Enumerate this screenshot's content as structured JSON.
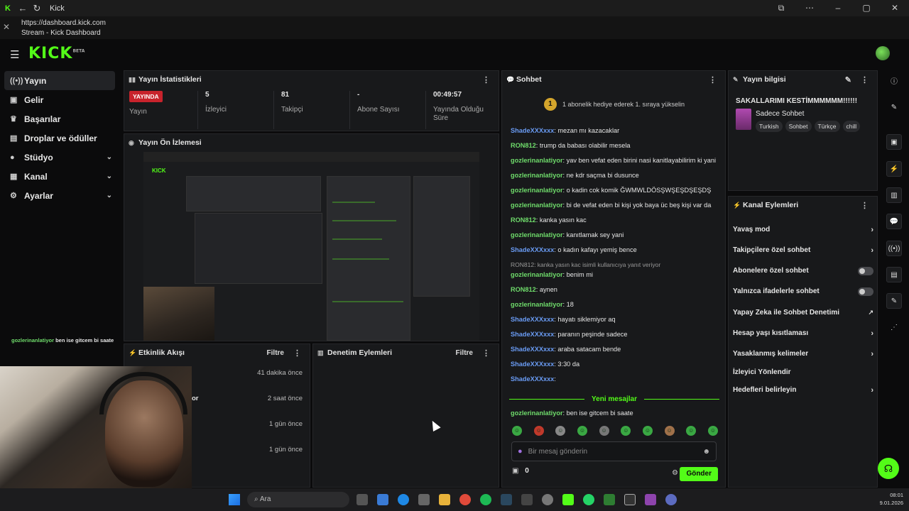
{
  "titlebar": {
    "title": "Kick"
  },
  "urlbar": {
    "url": "https://dashboard.kick.com",
    "page_title": "Stream - Kick Dashboard"
  },
  "brand": {
    "logo": "KICK",
    "logo_suffix": "BETA",
    "accent": "#53fc18"
  },
  "sidebar": {
    "items": [
      {
        "label": "Yayın",
        "icon": "broadcast-icon",
        "active": true
      },
      {
        "label": "Gelir",
        "icon": "revenue-icon"
      },
      {
        "label": "Başarılar",
        "icon": "trophy-icon"
      },
      {
        "label": "Droplar ve ödüller",
        "icon": "gift-icon"
      },
      {
        "label": "Stüdyo",
        "icon": "studio-icon",
        "expandable": true
      },
      {
        "label": "Kanal",
        "icon": "channel-icon",
        "expandable": true
      },
      {
        "label": "Ayarlar",
        "icon": "settings-icon",
        "expandable": true
      }
    ]
  },
  "stats": {
    "title": "Yayın İstatistikleri",
    "live_badge": "YAYINDA",
    "cells": [
      {
        "value": "",
        "label": "Yayın"
      },
      {
        "value": "5",
        "label": "İzleyici"
      },
      {
        "value": "81",
        "label": "Takipçi"
      },
      {
        "value": "-",
        "label": "Abone Sayısı"
      },
      {
        "value": "00:49:57",
        "label": "Yayında Olduğu Süre"
      }
    ]
  },
  "preview": {
    "title": "Yayın Ön İzlemesi"
  },
  "activity": {
    "title": "Etkinlik Akışı",
    "filter_label": "Filtre",
    "rows": [
      {
        "time": "41 dakika önce",
        "fragment": ""
      },
      {
        "time": "2 saat önce",
        "fragment": "or"
      },
      {
        "time": "1 gün önce",
        "fragment": ""
      },
      {
        "time": "1 gün önce",
        "fragment": ""
      }
    ]
  },
  "moderation": {
    "title": "Denetim Eylemleri",
    "filter_label": "Filtre"
  },
  "chat": {
    "title": "Sohbet",
    "pinned_num": "1",
    "pinned_text": "1 abonelik hediye ederek 1. sıraya yükselin",
    "messages": [
      {
        "user": "ShadeXXXxxx",
        "color": "b",
        "text": ": mezan mı kazacaklar"
      },
      {
        "user": "RON812",
        "color": "g",
        "text": ": trump da babası olabilir mesela"
      },
      {
        "user": "gozlerinanlatiyor",
        "color": "g",
        "text": ": yav ben vefat eden birini nasi kanitlayabilirim ki yani"
      },
      {
        "user": "gozlerinanlatiyor",
        "color": "g",
        "text": ": ne kdr saçma bi dusunce"
      },
      {
        "user": "gozlerinanlatiyor",
        "color": "g",
        "text": ": o kadin cok komik ĞWMWLDÖSŞWŞEŞDŞEŞDŞ"
      },
      {
        "user": "gozlerinanlatiyor",
        "color": "g",
        "text": ": bi de vefat eden bi kişi yok baya üc beş kişi var da"
      },
      {
        "user": "RON812",
        "color": "g",
        "text": ": kanka yasın kac"
      },
      {
        "user": "gozlerinanlatiyor",
        "color": "g",
        "text": ": kanıtlamak sey yani"
      },
      {
        "user": "ShadeXXXxxx",
        "color": "b",
        "text": ": o kadın kafayı yemiş bence"
      },
      {
        "reply": "RON812: kanka yasın kac isimli kullanıcıya yanıt veriyor"
      },
      {
        "user": "gozlerinanlatiyor",
        "color": "g",
        "text": ": benim mi"
      },
      {
        "user": "RON812",
        "color": "g",
        "text": ": aynen"
      },
      {
        "user": "gozlerinanlatiyor",
        "color": "g",
        "text": ": 18"
      },
      {
        "user": "ShadeXXXxxx",
        "color": "b",
        "text": ": hayatı siklemiyor aq"
      },
      {
        "user": "ShadeXXXxxx",
        "color": "b",
        "text": ": paranın peşinde sadece"
      },
      {
        "user": "ShadeXXXxxx",
        "color": "b",
        "text": ": araba satacam bende"
      },
      {
        "user": "ShadeXXXxxx",
        "color": "b",
        "text": ": 3:30 da"
      },
      {
        "user": "ShadeXXXxxx",
        "color": "b",
        "text": ":"
      }
    ],
    "new_messages_label": "Yeni mesajlar",
    "last_message": {
      "user": "gozlerinanlatiyor",
      "text": ": ben ise gitcem bi saate"
    },
    "input_placeholder": "Bir mesaj gönderin",
    "points": "0",
    "send_label": "Gönder"
  },
  "stream_info": {
    "title": "Yayın bilgisi",
    "stream_title": "SAKALLARIMI KESTİMMMMMM!!!!!!",
    "category": "Sadece Sohbet",
    "tags": [
      "Turkish",
      "Sohbet",
      "Türkçe",
      "chill"
    ]
  },
  "channel_actions": {
    "title": "Kanal Eylemleri",
    "items": [
      {
        "label": "Yavaş mod",
        "control": "chevron"
      },
      {
        "label": "Takipçilere özel sohbet",
        "control": "chevron"
      },
      {
        "label": "Abonelere özel sohbet",
        "control": "toggle",
        "on": false
      },
      {
        "label": "Yalnızca ifadelerle sohbet",
        "control": "toggle",
        "on": false
      },
      {
        "label": "Yapay Zeka ile Sohbet Denetimi",
        "control": "external"
      },
      {
        "label": "Hesap yaşı kısıtlaması",
        "control": "chevron"
      },
      {
        "label": "Yasaklanmış kelimeler",
        "control": "chevron"
      },
      {
        "label": "İzleyici Yönlendir",
        "control": "none"
      },
      {
        "label": "Hedefleri belirleyin",
        "control": "chevron"
      }
    ]
  },
  "overlay": {
    "user": "gozlerinanlatiyor",
    "text": " ben ise gitcem bi saate"
  },
  "taskbar": {
    "search_placeholder": "Ara",
    "time": "08:01",
    "date": "9.01.2026"
  }
}
